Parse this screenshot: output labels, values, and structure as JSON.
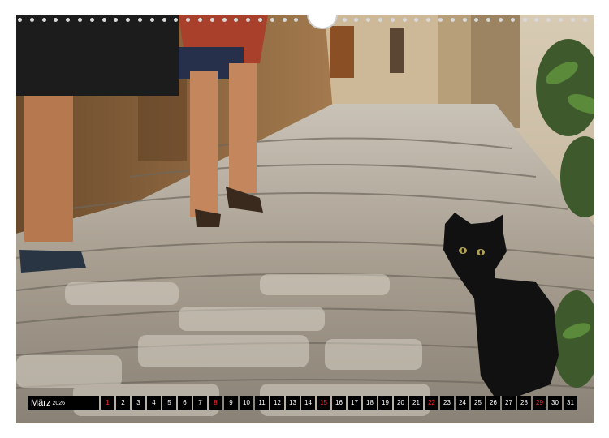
{
  "calendar": {
    "month": "März",
    "year": "2026",
    "days": [
      "1",
      "2",
      "3",
      "4",
      "5",
      "6",
      "7",
      "8",
      "9",
      "10",
      "11",
      "12",
      "13",
      "14",
      "15",
      "16",
      "17",
      "18",
      "19",
      "20",
      "21",
      "22",
      "23",
      "24",
      "25",
      "26",
      "27",
      "28",
      "29",
      "30",
      "31"
    ],
    "sundays": [
      "1",
      "8",
      "15",
      "22",
      "29"
    ],
    "weekday_color": "#ffffff",
    "sunday_color": "#ff2b2b",
    "bar_color": "#000000"
  },
  "photo": {
    "subject": "black-cat-icon"
  }
}
